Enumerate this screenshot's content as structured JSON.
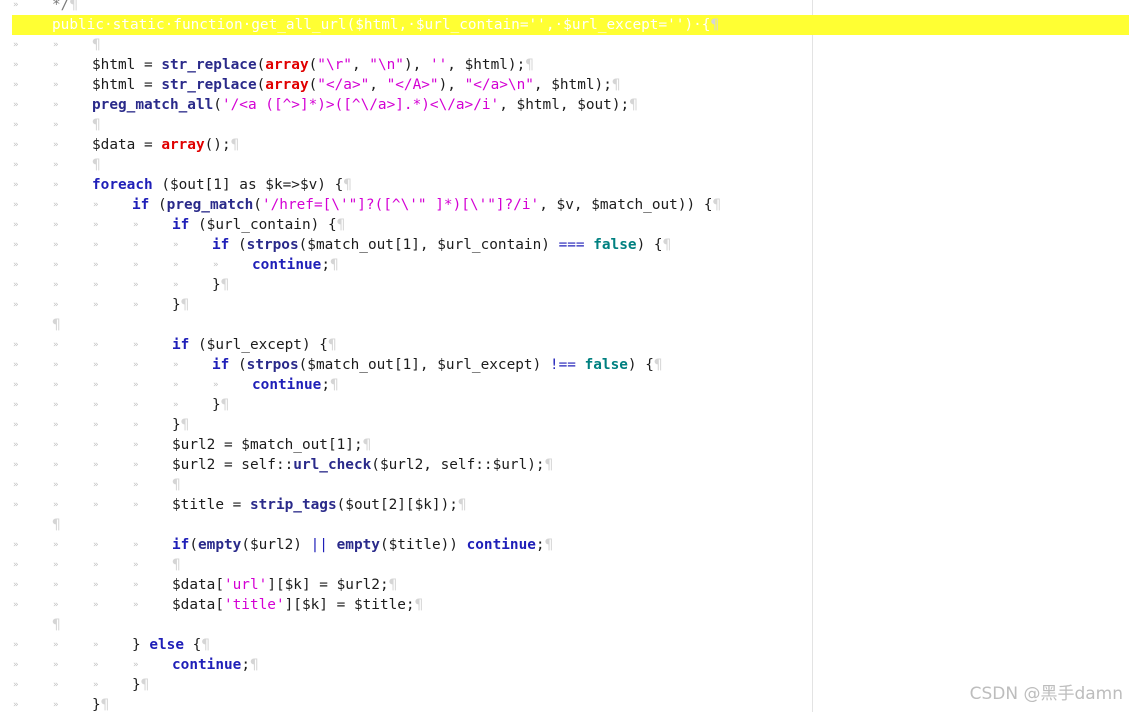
{
  "editor": {
    "lines": [
      {
        "indent": 1,
        "segments": [
          {
            "c": "cm",
            "t": "*/"
          }
        ],
        "pilcrow": true
      },
      {
        "indent": 0,
        "highlight": true,
        "selected": true,
        "segments": [
          {
            "c": "sel-text",
            "t": "public·static·function·get_all_url($html,·$url_contain='',·$url_except='')·{"
          }
        ],
        "pilcrow": true
      },
      {
        "indent": 2,
        "segments": [],
        "pilcrow": true
      },
      {
        "indent": 2,
        "segments": [
          {
            "c": "tx",
            "t": "$html = "
          },
          {
            "c": "fn",
            "t": "str_replace"
          },
          {
            "c": "tx",
            "t": "("
          },
          {
            "c": "rd",
            "t": "array"
          },
          {
            "c": "tx",
            "t": "("
          },
          {
            "c": "st",
            "t": "\"\\r\""
          },
          {
            "c": "tx",
            "t": ", "
          },
          {
            "c": "st",
            "t": "\"\\n\""
          },
          {
            "c": "tx",
            "t": "), "
          },
          {
            "c": "st",
            "t": "''"
          },
          {
            "c": "tx",
            "t": ", $html);"
          }
        ],
        "pilcrow": true
      },
      {
        "indent": 2,
        "segments": [
          {
            "c": "tx",
            "t": "$html = "
          },
          {
            "c": "fn",
            "t": "str_replace"
          },
          {
            "c": "tx",
            "t": "("
          },
          {
            "c": "rd",
            "t": "array"
          },
          {
            "c": "tx",
            "t": "("
          },
          {
            "c": "st",
            "t": "\"</a>\""
          },
          {
            "c": "tx",
            "t": ", "
          },
          {
            "c": "st",
            "t": "\"</A>\""
          },
          {
            "c": "tx",
            "t": "), "
          },
          {
            "c": "st",
            "t": "\"</a>\\n\""
          },
          {
            "c": "tx",
            "t": ", $html);"
          }
        ],
        "pilcrow": true
      },
      {
        "indent": 2,
        "segments": [
          {
            "c": "fn",
            "t": "preg_match_all"
          },
          {
            "c": "tx",
            "t": "("
          },
          {
            "c": "st",
            "t": "'/<a ([^>]*)>([^\\/a>].*)<\\/a>/i'"
          },
          {
            "c": "tx",
            "t": ", $html, $out);"
          }
        ],
        "pilcrow": true
      },
      {
        "indent": 2,
        "segments": [],
        "pilcrow": true
      },
      {
        "indent": 2,
        "segments": [
          {
            "c": "tx",
            "t": "$data = "
          },
          {
            "c": "rd",
            "t": "array"
          },
          {
            "c": "tx",
            "t": "();"
          }
        ],
        "pilcrow": true
      },
      {
        "indent": 2,
        "segments": [],
        "pilcrow": true
      },
      {
        "indent": 2,
        "segments": [
          {
            "c": "kw",
            "t": "foreach"
          },
          {
            "c": "tx",
            "t": " ($out[1] as $k=>$v) {"
          }
        ],
        "pilcrow": true
      },
      {
        "indent": 3,
        "segments": [
          {
            "c": "kw",
            "t": "if"
          },
          {
            "c": "tx",
            "t": " ("
          },
          {
            "c": "fn",
            "t": "preg_match"
          },
          {
            "c": "tx",
            "t": "("
          },
          {
            "c": "st",
            "t": "'/href=[\\'\"]?([^\\'\" ]*)[\\'\"]?/i'"
          },
          {
            "c": "tx",
            "t": ", $v, $match_out)) {"
          }
        ],
        "pilcrow": true
      },
      {
        "indent": 4,
        "segments": [
          {
            "c": "kw",
            "t": "if"
          },
          {
            "c": "tx",
            "t": " ($url_contain) {"
          }
        ],
        "pilcrow": true
      },
      {
        "indent": 5,
        "segments": [
          {
            "c": "kw",
            "t": "if"
          },
          {
            "c": "tx",
            "t": " ("
          },
          {
            "c": "fn",
            "t": "strpos"
          },
          {
            "c": "tx",
            "t": "($match_out[1], $url_contain) "
          },
          {
            "c": "op",
            "t": "==="
          },
          {
            "c": "tx",
            "t": " "
          },
          {
            "c": "bl",
            "t": "false"
          },
          {
            "c": "tx",
            "t": ") {"
          }
        ],
        "pilcrow": true
      },
      {
        "indent": 6,
        "segments": [
          {
            "c": "kb",
            "t": "continue"
          },
          {
            "c": "tx",
            "t": ";"
          }
        ],
        "pilcrow": true
      },
      {
        "indent": 5,
        "segments": [
          {
            "c": "tx",
            "t": "}"
          }
        ],
        "pilcrow": true
      },
      {
        "indent": 4,
        "segments": [
          {
            "c": "tx",
            "t": "}"
          }
        ],
        "pilcrow": true
      },
      {
        "indent": 0,
        "segments": [],
        "pilcrow": true
      },
      {
        "indent": 4,
        "segments": [
          {
            "c": "kw",
            "t": "if"
          },
          {
            "c": "tx",
            "t": " ($url_except) {"
          }
        ],
        "pilcrow": true
      },
      {
        "indent": 5,
        "segments": [
          {
            "c": "kw",
            "t": "if"
          },
          {
            "c": "tx",
            "t": " ("
          },
          {
            "c": "fn",
            "t": "strpos"
          },
          {
            "c": "tx",
            "t": "($match_out[1], $url_except) "
          },
          {
            "c": "op",
            "t": "!=="
          },
          {
            "c": "tx",
            "t": " "
          },
          {
            "c": "bl",
            "t": "false"
          },
          {
            "c": "tx",
            "t": ") {"
          }
        ],
        "pilcrow": true
      },
      {
        "indent": 6,
        "segments": [
          {
            "c": "kb",
            "t": "continue"
          },
          {
            "c": "tx",
            "t": ";"
          }
        ],
        "pilcrow": true
      },
      {
        "indent": 5,
        "segments": [
          {
            "c": "tx",
            "t": "}"
          }
        ],
        "pilcrow": true
      },
      {
        "indent": 4,
        "segments": [
          {
            "c": "tx",
            "t": "}"
          }
        ],
        "pilcrow": true
      },
      {
        "indent": 4,
        "segments": [
          {
            "c": "tx",
            "t": "$url2 = $match_out[1];"
          }
        ],
        "pilcrow": true
      },
      {
        "indent": 4,
        "segments": [
          {
            "c": "tx",
            "t": "$url2 = self::"
          },
          {
            "c": "fn",
            "t": "url_check"
          },
          {
            "c": "tx",
            "t": "($url2, self::$url);"
          }
        ],
        "pilcrow": true
      },
      {
        "indent": 4,
        "segments": [],
        "pilcrow": true
      },
      {
        "indent": 4,
        "segments": [
          {
            "c": "tx",
            "t": "$title = "
          },
          {
            "c": "fn",
            "t": "strip_tags"
          },
          {
            "c": "tx",
            "t": "($out[2][$k]);"
          }
        ],
        "pilcrow": true
      },
      {
        "indent": 0,
        "segments": [],
        "pilcrow": true
      },
      {
        "indent": 4,
        "segments": [
          {
            "c": "kw",
            "t": "if"
          },
          {
            "c": "tx",
            "t": "("
          },
          {
            "c": "fn",
            "t": "empty"
          },
          {
            "c": "tx",
            "t": "($url2) "
          },
          {
            "c": "op",
            "t": "||"
          },
          {
            "c": "tx",
            "t": " "
          },
          {
            "c": "fn",
            "t": "empty"
          },
          {
            "c": "tx",
            "t": "($title)) "
          },
          {
            "c": "kw",
            "t": "continue"
          },
          {
            "c": "tx",
            "t": ";"
          }
        ],
        "pilcrow": true
      },
      {
        "indent": 4,
        "segments": [],
        "pilcrow": true
      },
      {
        "indent": 4,
        "segments": [
          {
            "c": "tx",
            "t": "$data["
          },
          {
            "c": "st",
            "t": "'url'"
          },
          {
            "c": "tx",
            "t": "][$k] = $url2;"
          }
        ],
        "pilcrow": true
      },
      {
        "indent": 4,
        "segments": [
          {
            "c": "tx",
            "t": "$data["
          },
          {
            "c": "st",
            "t": "'title'"
          },
          {
            "c": "tx",
            "t": "][$k] = $title;"
          }
        ],
        "pilcrow": true
      },
      {
        "indent": 0,
        "segments": [],
        "pilcrow": true
      },
      {
        "indent": 3,
        "segments": [
          {
            "c": "tx",
            "t": "} "
          },
          {
            "c": "kw",
            "t": "else"
          },
          {
            "c": "tx",
            "t": " {"
          }
        ],
        "pilcrow": true
      },
      {
        "indent": 4,
        "segments": [
          {
            "c": "kb",
            "t": "continue"
          },
          {
            "c": "tx",
            "t": ";"
          }
        ],
        "pilcrow": true
      },
      {
        "indent": 3,
        "segments": [
          {
            "c": "tx",
            "t": "}"
          }
        ],
        "pilcrow": true
      },
      {
        "indent": 2,
        "segments": [
          {
            "c": "tx",
            "t": "}"
          }
        ],
        "pilcrow": true
      }
    ],
    "pilcrow_glyph": "¶",
    "tab_glyph": "»"
  },
  "watermark": {
    "text": "CSDN @黑手damn"
  }
}
